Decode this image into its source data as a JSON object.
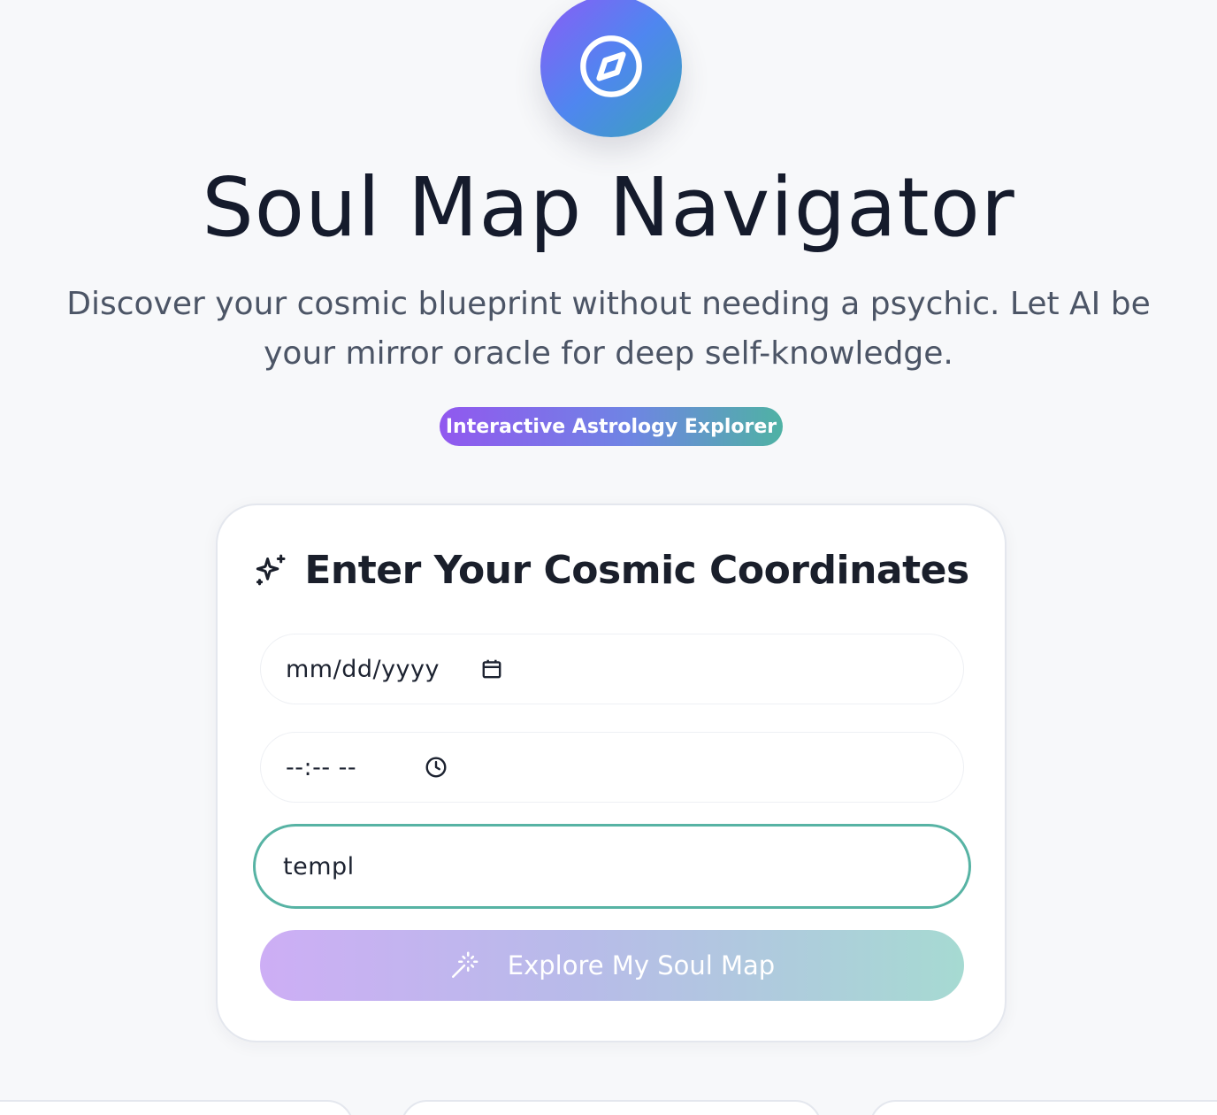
{
  "header": {
    "logo_icon": "compass-icon",
    "title": "Soul Map Navigator",
    "subtitle": "Discover your cosmic blueprint without needing a psychic. Let AI be your mirror oracle for deep self-knowledge.",
    "badge": "Interactive Astrology Explorer"
  },
  "form": {
    "title": "Enter Your Cosmic Coordinates",
    "title_icon": "sparkles-icon",
    "date": {
      "placeholder": "mm/dd/yyyy",
      "icon": "calendar-icon"
    },
    "time": {
      "placeholder": "--:-- --",
      "icon": "clock-icon"
    },
    "place": {
      "value": "templ"
    },
    "submit": {
      "label": "Explore My Soul Map",
      "icon": "magic-wand-icon"
    }
  },
  "colors": {
    "background": "#f7f8fa",
    "accent_purple": "#8b5cf6",
    "accent_blue": "#4f86f0",
    "accent_teal": "#57b3a4",
    "title_text": "#151b2c",
    "subtitle_text": "#4c5566"
  }
}
